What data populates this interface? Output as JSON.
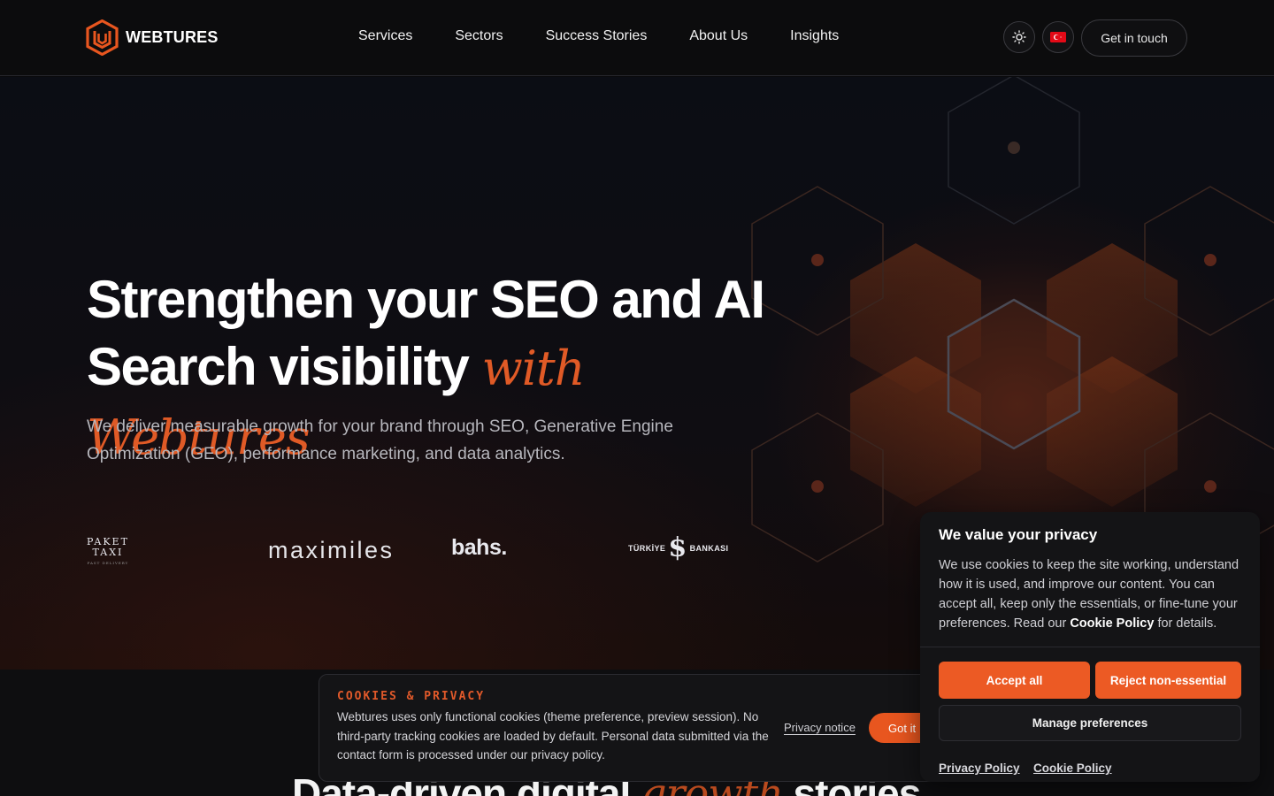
{
  "brand": {
    "name": "WEBTURES",
    "accent_color": "#e8561f"
  },
  "header": {
    "nav": [
      "Services",
      "Sectors",
      "Success Stories",
      "About Us",
      "Insights"
    ],
    "theme_toggle_icon": "sun-icon",
    "language_flag_icon": "turkey-flag-icon",
    "cta_label": "Get in touch"
  },
  "hero": {
    "headline_line1": "Strengthen your SEO and AI",
    "headline_line2": "Search visibility",
    "headline_accent": "with Webtures",
    "subtitle": "We deliver measurable growth for your brand through SEO, Generative Engine Optimization (GEO), performance marketing, and data analytics.",
    "client_logos": {
      "paket_taxi_top": "PAKET",
      "paket_taxi_bottom": "TAXI",
      "paket_taxi_tag": "FAST DELIVERY",
      "maximiles": "maximiles",
      "bahs": "bahs.",
      "isbank_left": "TÜRKİYE",
      "isbank_symbol": "$",
      "isbank_right": "BANKASI"
    }
  },
  "section2": {
    "title_start": "Data-driven digital",
    "title_accent": "growth",
    "title_end": "stories"
  },
  "cookie_bar": {
    "title": "COOKIES & PRIVACY",
    "text": "Webtures uses only functional cookies (theme preference, preview session). No third-party tracking cookies are loaded by default. Personal data submitted via the contact form is processed under our privacy policy.",
    "privacy_link": "Privacy notice",
    "button": "Got it"
  },
  "privacy_modal": {
    "title": "We value your privacy",
    "text_before": "We use cookies to keep the site working, understand how it is used, and improve our content. You can accept all, keep only the essentials, or fine-tune your preferences. Read our",
    "text_link": "Cookie Policy",
    "text_after": "for details.",
    "accept": "Accept all",
    "reject": "Reject non-essential",
    "manage": "Manage preferences",
    "footer_links": [
      "Privacy Policy",
      "Cookie Policy"
    ]
  }
}
